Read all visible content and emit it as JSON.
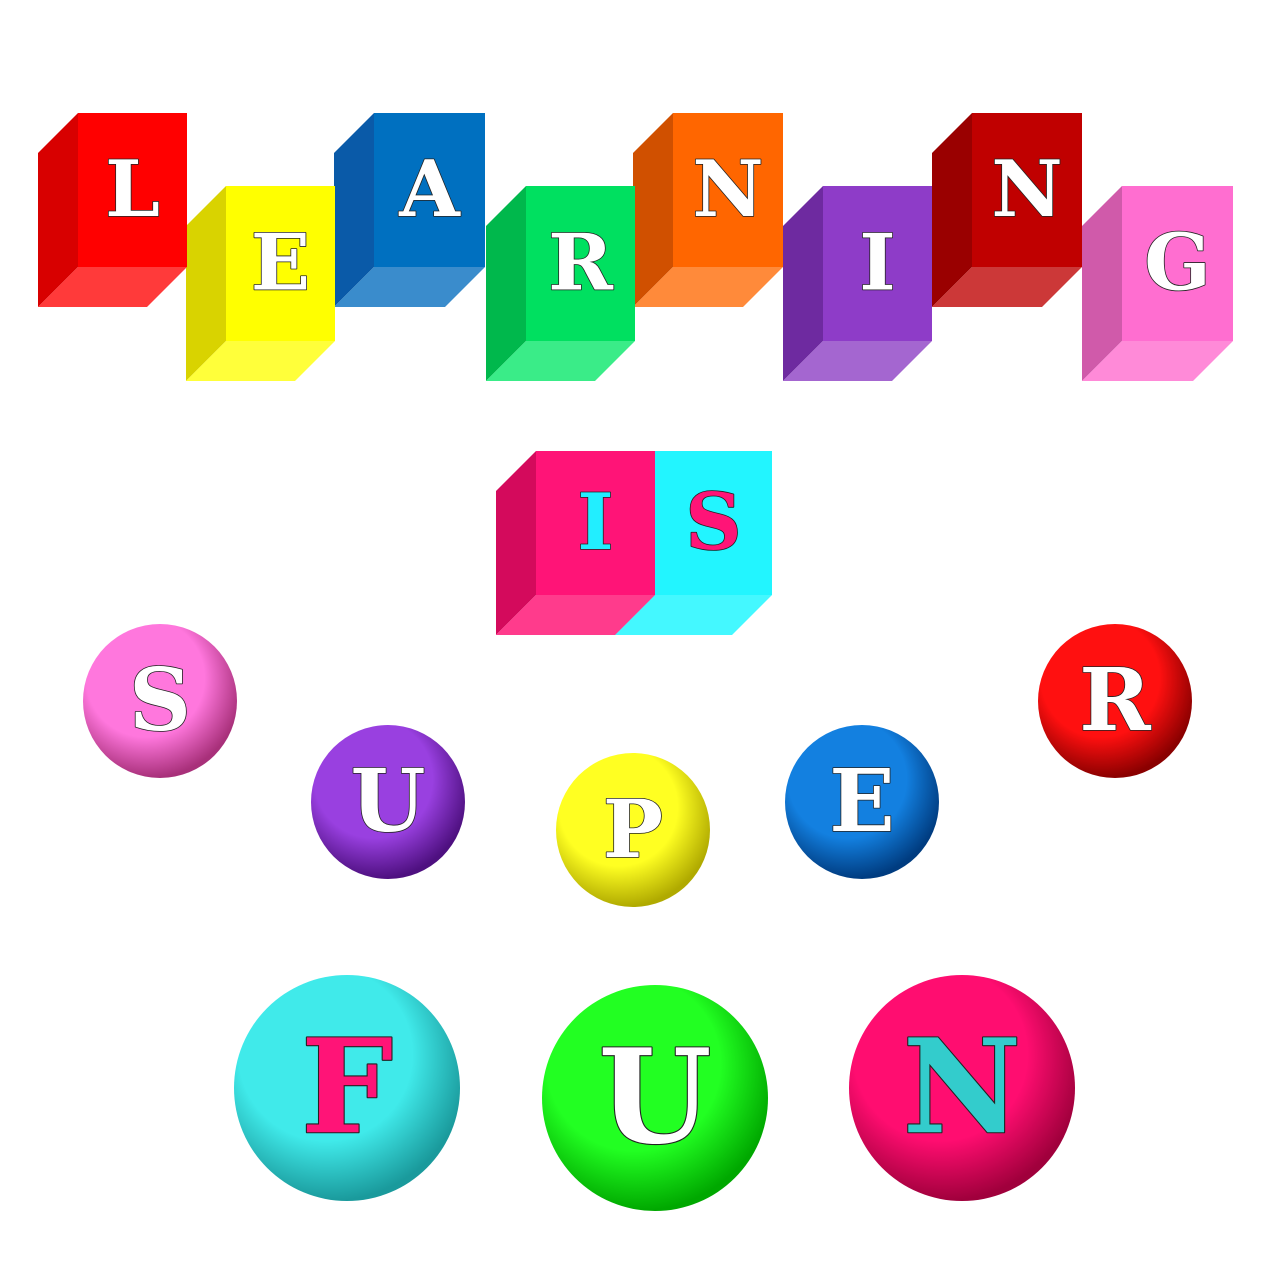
{
  "words": [
    {
      "text": "LEARNING",
      "shape": "block",
      "letters": [
        {
          "char": "L",
          "face": "#ff0000",
          "side": "#d80000",
          "bottom": "#ff3a3a",
          "text_color": "#ffffff"
        },
        {
          "char": "E",
          "face": "#ffff00",
          "side": "#d9d300",
          "bottom": "#ffff3a",
          "text_color": "#ffffff"
        },
        {
          "char": "A",
          "face": "#0070c0",
          "side": "#0a5aa8",
          "bottom": "#3a8ccc",
          "text_color": "#ffffff"
        },
        {
          "char": "R",
          "face": "#00e060",
          "side": "#00b84c",
          "bottom": "#3aec88",
          "text_color": "#ffffff"
        },
        {
          "char": "N",
          "face": "#ff6600",
          "side": "#d05000",
          "bottom": "#ff8a3a",
          "text_color": "#ffffff"
        },
        {
          "char": "I",
          "face": "#8e3cc8",
          "side": "#6e2aa0",
          "bottom": "#a466d0",
          "text_color": "#ffffff"
        },
        {
          "char": "N",
          "face": "#c00000",
          "side": "#9a0000",
          "bottom": "#cc3838",
          "text_color": "#ffffff"
        },
        {
          "char": "G",
          "face": "#ff6ed0",
          "side": "#d05aaa",
          "bottom": "#ff8ad8",
          "text_color": "#ffffff"
        }
      ]
    },
    {
      "text": "IS",
      "shape": "block",
      "letters": [
        {
          "char": "I",
          "face": "#ff1477",
          "side": "#d40a5c",
          "bottom": "#ff3b8c",
          "text_color": "#22eeff"
        },
        {
          "char": "S",
          "face": "#22f5ff",
          "side": "#00cfe0",
          "bottom": "#44f8ff",
          "text_color": "#ff1477"
        }
      ]
    },
    {
      "text": "SUPER",
      "shape": "ball",
      "letters": [
        {
          "char": "S",
          "color": "#ff77dd",
          "dark": "#a8307a",
          "text_color": "#ffffff"
        },
        {
          "char": "U",
          "color": "#9940e0",
          "dark": "#4e1080",
          "text_color": "#ffffff"
        },
        {
          "char": "P",
          "color": "#ffff22",
          "dark": "#b0aa00",
          "text_color": "#ffffff"
        },
        {
          "char": "E",
          "color": "#1380e0",
          "dark": "#003c80",
          "text_color": "#ffffff"
        },
        {
          "char": "R",
          "color": "#ff1010",
          "dark": "#8a0000",
          "text_color": "#ffffff"
        }
      ]
    },
    {
      "text": "FUN",
      "shape": "ball",
      "letters": [
        {
          "char": "F",
          "color": "#40eaea",
          "dark": "#1a9a9c",
          "text_color": "#ff1477"
        },
        {
          "char": "U",
          "color": "#22ff22",
          "dark": "#00a800",
          "text_color": "#ffffff"
        },
        {
          "char": "N",
          "color": "#ff0d70",
          "dark": "#a0003c",
          "text_color": "#33cccc"
        }
      ]
    }
  ]
}
